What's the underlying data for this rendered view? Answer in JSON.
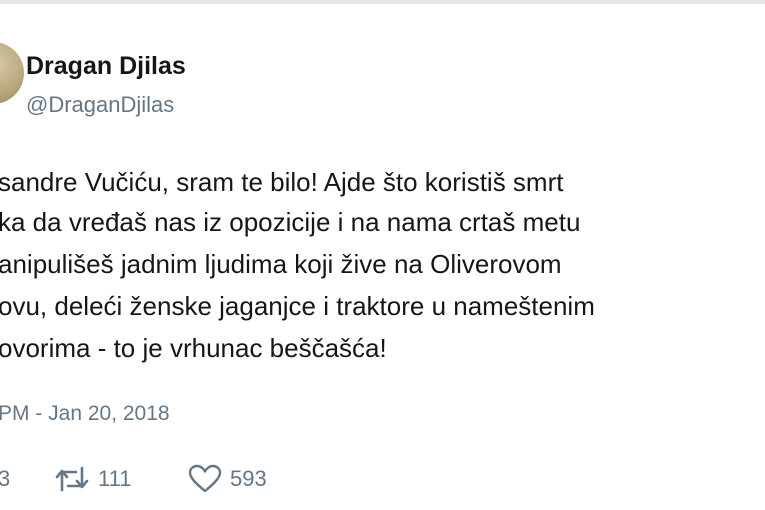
{
  "tweet": {
    "author": {
      "display_name": "Dragan Djilas",
      "handle": "@DraganDjilas"
    },
    "text_lines": [
      "sandre Vučiću, sram te bilo! Ajde što koristiš smrt",
      "ka da vređaš nas iz opozicije i na nama crtaš metu",
      "anipulišeš jadnim ljudima koji žive na Oliverovom",
      "ovu, deleći ženske jaganjce i traktore u nameštenim",
      "ovorima - to je vrhunac beščašća!"
    ],
    "timestamp": "PM - Jan 20, 2018",
    "actions": {
      "reply_count": "3",
      "retweet_count": "111",
      "like_count": "593"
    }
  },
  "icons": {
    "avatar": "profile-photo",
    "reply": "reply-icon",
    "retweet": "retweet-icon",
    "like": "heart-icon"
  },
  "colors": {
    "text": "#14171a",
    "secondary": "#657786"
  }
}
